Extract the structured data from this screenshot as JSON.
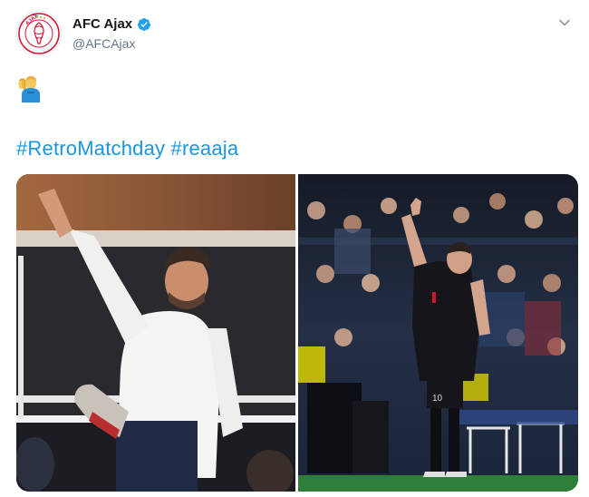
{
  "tweet": {
    "display_name": "AFC Ajax",
    "handle": "@AFCAjax",
    "verified": true,
    "avatar_icon": "ajax-crest-icon",
    "avatar_text": "AJAX",
    "caret_icon": "chevron-down-icon",
    "emoji": "person-raising-hand-emoji",
    "hashtags": [
      "#RetroMatchday",
      "#reaaja"
    ],
    "media": [
      {
        "name": "photo-spectator-saluting",
        "description_icon": "photo"
      },
      {
        "name": "photo-player-celebrating",
        "shirt_number": "10"
      }
    ]
  },
  "colors": {
    "link": "#1b95e0",
    "verified": "#1da1f2",
    "name": "#14171a",
    "handle": "#657786",
    "ajax_red": "#d2122e"
  }
}
